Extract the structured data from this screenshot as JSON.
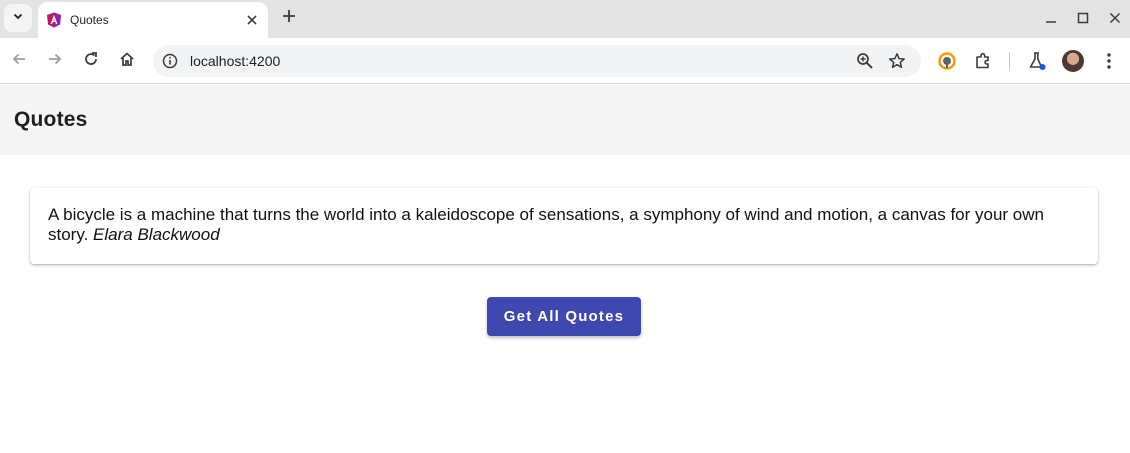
{
  "browser": {
    "tab_title": "Quotes",
    "url": "localhost:4200"
  },
  "icons": {
    "tab_search": "chevron-down-icon",
    "favicon": "angular-icon",
    "tab_close": "close-icon",
    "new_tab": "plus-icon",
    "minimize": "minimize-icon",
    "maximize": "maximize-icon",
    "close_window": "close-icon",
    "back": "arrow-left-icon",
    "forward": "arrow-right-icon",
    "reload": "reload-icon",
    "home": "home-icon",
    "site_info": "info-icon",
    "zoom": "zoom-icon",
    "bookmark": "star-icon",
    "extension_1": "vpn-extension-icon",
    "extensions": "puzzle-icon",
    "labs": "flask-icon",
    "menu": "kebab-menu-icon"
  },
  "app": {
    "title": "Quotes"
  },
  "quote": {
    "text": "A bicycle is a machine that turns the world into a kaleidoscope of sensations, a symphony of wind and motion, a canvas for your own story.",
    "author": "Elara Blackwood"
  },
  "actions": {
    "get_all_label": "Get All Quotes"
  },
  "colors": {
    "primary": "#3f48b0",
    "header_bg": "#f4f4f4",
    "tabstrip_bg": "#e3e3e3"
  }
}
